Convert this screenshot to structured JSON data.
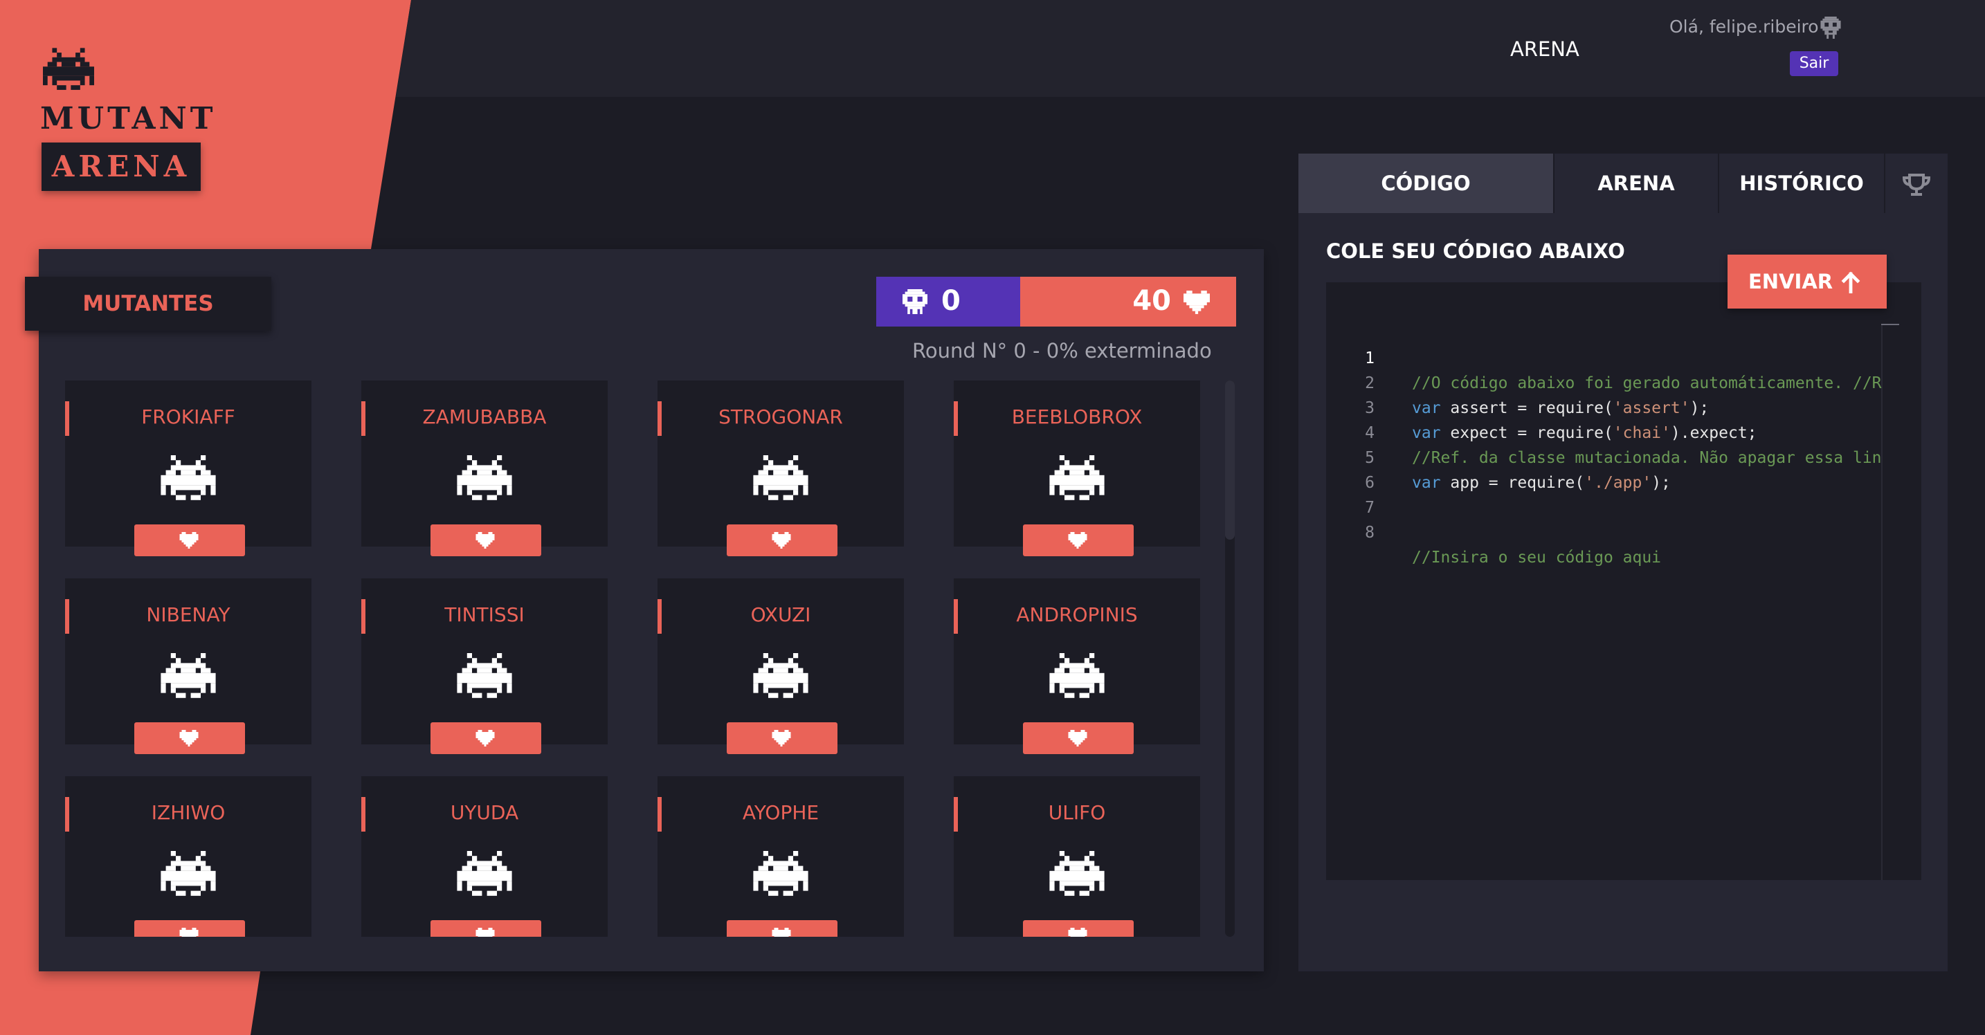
{
  "brand": {
    "line1": "MUTANT",
    "line2": "ARENA"
  },
  "header": {
    "nav_arena": "ARENA",
    "greeting": "Olá, felipe.ribeiro",
    "logout": "Sair"
  },
  "mutants_panel": {
    "title": "MUTANTES",
    "kills": "0",
    "lives": "40",
    "round_text": "Round N° 0 - 0% exterminado",
    "mutants": [
      "FROKIAFF",
      "ZAMUBABBA",
      "STROGONAR",
      "BEEBLOBROX",
      "NIBENAY",
      "TINTISSI",
      "OXUZI",
      "ANDROPINIS",
      "IZHIWO",
      "UYUDA",
      "AYOPHE",
      "ULIFO"
    ]
  },
  "code_panel": {
    "tabs": [
      "CÓDIGO",
      "ARENA",
      "HISTÓRICO"
    ],
    "paste_label": "COLE SEU CÓDIGO ABAIXO",
    "send_label": "ENVIAR",
    "line_numbers": [
      "1",
      "2",
      "3",
      "4",
      "5",
      "6",
      "7",
      "8"
    ]
  },
  "colors": {
    "coral": "#ea6358",
    "purple": "#5433b5",
    "background": "#1c1c25",
    "panel": "#262633"
  }
}
